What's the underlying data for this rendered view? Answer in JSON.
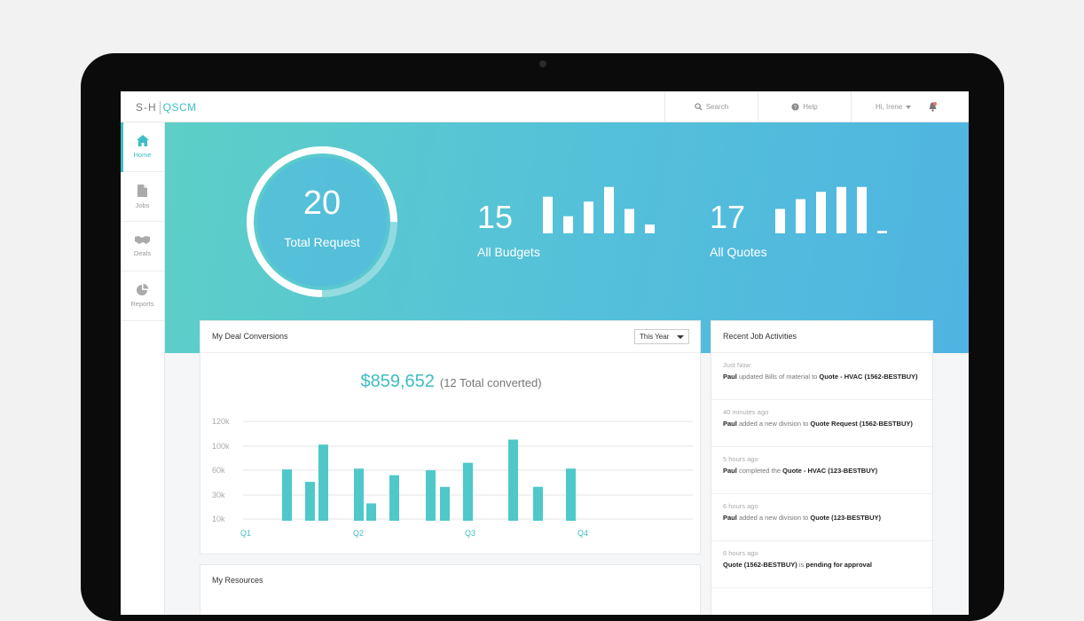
{
  "topbar": {
    "logo_brand": "S-H",
    "logo_app": "QSCM",
    "search": "Search",
    "help": "Help",
    "user": "Hi, Irene"
  },
  "sidebar": {
    "items": [
      {
        "label": "Home",
        "icon": "home-icon",
        "active": true
      },
      {
        "label": "Jobs",
        "icon": "document-icon",
        "active": false
      },
      {
        "label": "Deals",
        "icon": "handshake-icon",
        "active": false
      },
      {
        "label": "Reports",
        "icon": "pie-chart-icon",
        "active": false
      }
    ]
  },
  "hero": {
    "total": {
      "value": "20",
      "label": "Total Request",
      "progress": 0.75
    },
    "budgets": {
      "value": "15",
      "label": "All Budgets",
      "bars": [
        0.75,
        0.35,
        0.65,
        0.95,
        0.5,
        0.18
      ]
    },
    "quotes": {
      "value": "17",
      "label": "All Quotes",
      "bars": [
        0.5,
        0.7,
        0.85,
        0.95,
        0.95,
        0.05
      ]
    }
  },
  "deal": {
    "title": "My Deal Conversions",
    "filter": "This Year",
    "amount": "$859,652",
    "converted": "(12 Total converted)"
  },
  "chart_data": {
    "type": "bar",
    "y_ticks": [
      "120k",
      "100k",
      "60k",
      "30k",
      "10k"
    ],
    "quarters": [
      "Q1",
      "Q2",
      "Q3",
      "Q4"
    ],
    "values": [
      62,
      47,
      92,
      63,
      21,
      55,
      61,
      41,
      70,
      98,
      41,
      63
    ],
    "ylim": [
      0,
      120
    ]
  },
  "resources": {
    "title": "My Resources"
  },
  "activities": {
    "title": "Recent Job Activities",
    "items": [
      {
        "time": "Just Now",
        "actor": "Paul",
        "text": "updated Bills of material to",
        "target": "Quote - HVAC (1562-BESTBUY)"
      },
      {
        "time": "40 minutes ago",
        "actor": "Paul",
        "text": "added a new division to",
        "target": "Quote Request (1562-BESTBUY)"
      },
      {
        "time": "5 hours ago",
        "actor": "Paul",
        "text": "completed the",
        "target": "Quote - HVAC (123-BESTBUY)"
      },
      {
        "time": "6 hours ago",
        "actor": "Paul",
        "text": "added a new division to",
        "target": "Quote (123-BESTBUY)"
      },
      {
        "time": "6 hours ago",
        "actor": "Quote (1562-BESTBUY)",
        "text": "is",
        "target": "pending for approval"
      }
    ]
  },
  "colors": {
    "accent": "#3dbdc4",
    "bar": "#4fc8c9"
  }
}
